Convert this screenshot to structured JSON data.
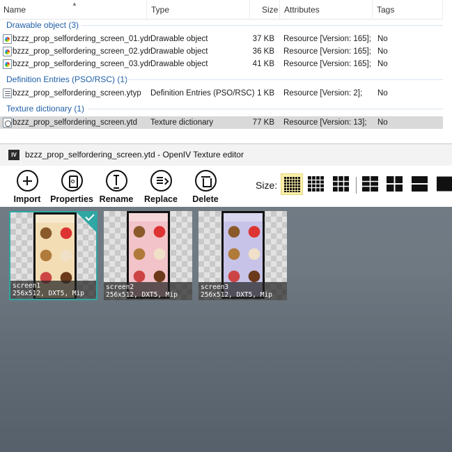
{
  "explorer": {
    "columns": {
      "name": "Name",
      "type": "Type",
      "size": "Size",
      "attributes": "Attributes",
      "tags": "Tags"
    },
    "groups": [
      {
        "title": "Drawable object (3)",
        "files": [
          {
            "name": "bzzz_prop_selfordering_screen_01.ydr",
            "type": "Drawable object",
            "size": "37 KB",
            "attributes": "Resource [Version: 165];",
            "tags": "No",
            "icon": "drawable-icon"
          },
          {
            "name": "bzzz_prop_selfordering_screen_02.ydr",
            "type": "Drawable object",
            "size": "36 KB",
            "attributes": "Resource [Version: 165];",
            "tags": "No",
            "icon": "drawable-icon"
          },
          {
            "name": "bzzz_prop_selfordering_screen_03.ydr",
            "type": "Drawable object",
            "size": "41 KB",
            "attributes": "Resource [Version: 165];",
            "tags": "No",
            "icon": "drawable-icon"
          }
        ]
      },
      {
        "title": "Definition Entries (PSO/RSC) (1)",
        "files": [
          {
            "name": "bzzz_prop_selfordering_screen.ytyp",
            "type": "Definition Entries (PSO/RSC)",
            "size": "1 KB",
            "attributes": "Resource [Version: 2];",
            "tags": "No",
            "icon": "definition-icon"
          }
        ]
      },
      {
        "title": "Texture dictionary (1)",
        "files": [
          {
            "name": "bzzz_prop_selfordering_screen.ytd",
            "type": "Texture dictionary",
            "size": "77 KB",
            "attributes": "Resource [Version: 13];",
            "tags": "No",
            "icon": "texture-dictionary-icon",
            "selected": true
          }
        ]
      }
    ]
  },
  "editor": {
    "logo_text": "IV",
    "title": "bzzz_prop_selfordering_screen.ytd - OpenIV Texture editor",
    "toolbar": {
      "import": "Import",
      "properties": "Properties",
      "rename": "Rename",
      "replace": "Replace",
      "delete": "Delete",
      "size_label": "Size:"
    },
    "textures": [
      {
        "name": "screen1",
        "info": "256x512, DXT5, Mip",
        "selected": true,
        "tint": "#f3ddb4"
      },
      {
        "name": "screen2",
        "info": "256x512, DXT5, Mip",
        "selected": false,
        "tint": "#f2c3c8"
      },
      {
        "name": "screen3",
        "info": "256x512, DXT5, Mip",
        "selected": false,
        "tint": "#c7c3e8"
      }
    ]
  }
}
